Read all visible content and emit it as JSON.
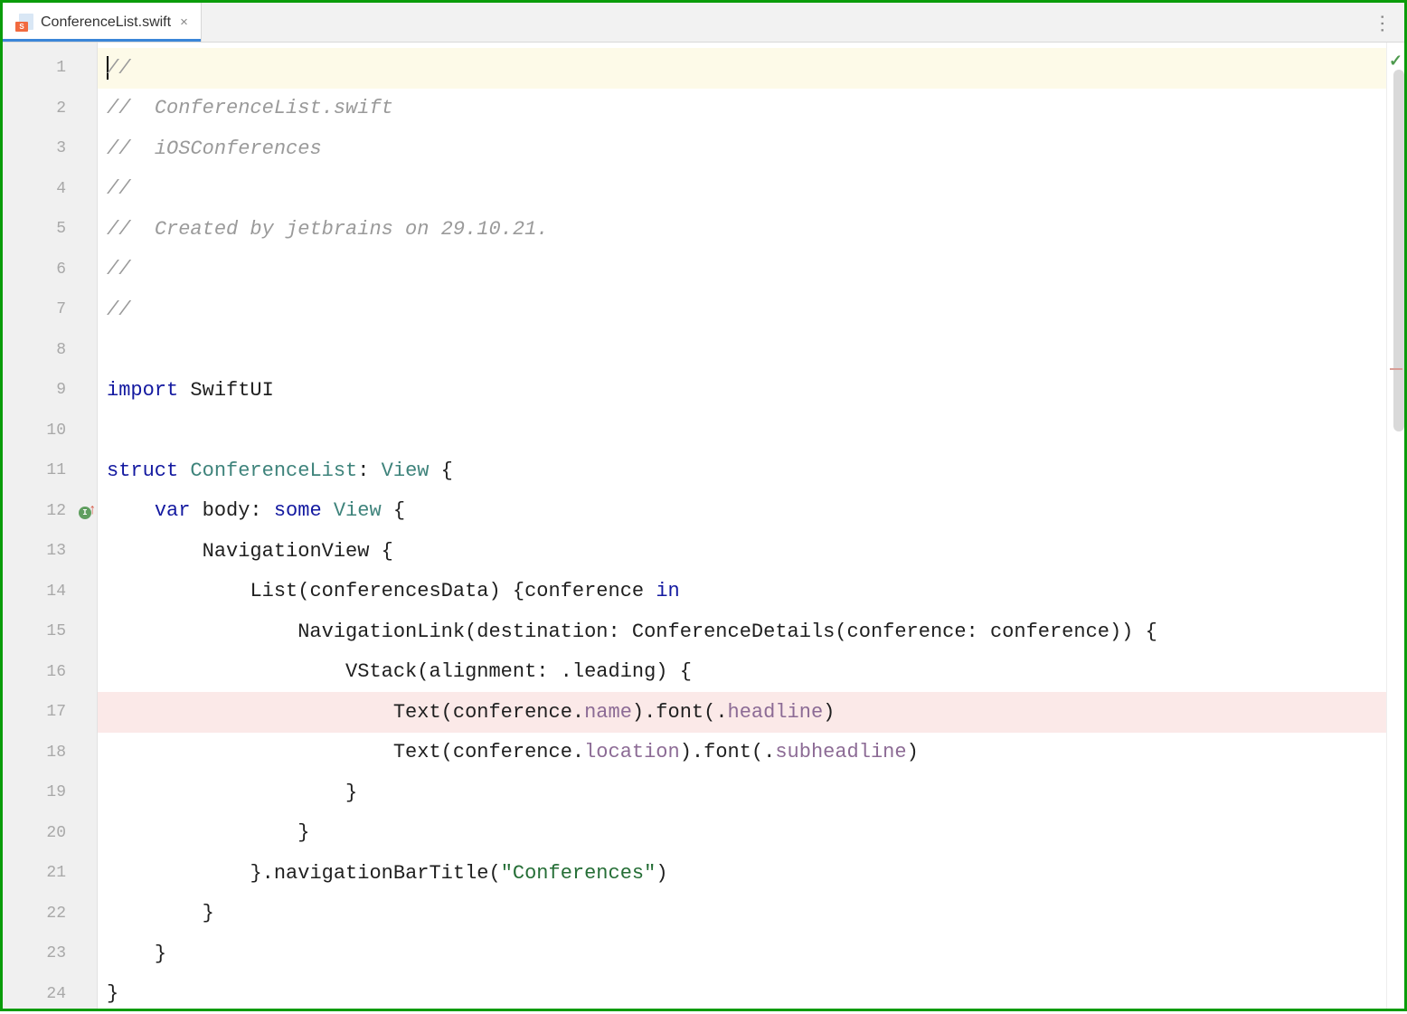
{
  "tab": {
    "filename": "ConferenceList.swift",
    "icon": "swift-file-icon"
  },
  "lineNumbers": [
    "1",
    "2",
    "3",
    "4",
    "5",
    "6",
    "7",
    "8",
    "9",
    "10",
    "11",
    "12",
    "13",
    "14",
    "15",
    "16",
    "17",
    "18",
    "19",
    "20",
    "21",
    "22",
    "23",
    "24"
  ],
  "gutterMarkers": {
    "12": "inspection-up",
    "17": "breakpoint"
  },
  "code": {
    "l1": "//",
    "l2_pre": "//  ",
    "l2_text": "ConferenceList.swift",
    "l3_pre": "//  ",
    "l3_text": "iOSConferences",
    "l4": "//",
    "l5_pre": "//  ",
    "l5_text": "Created by jetbrains on 29.10.21.",
    "l6": "//",
    "l7": "//",
    "l9_kw": "import",
    "l9_mod": " SwiftUI",
    "l11_kw": "struct",
    "l11_name": " ConferenceList",
    "l11_colon": ": ",
    "l11_proto": "View",
    "l11_brace": " {",
    "l12_indent": "    ",
    "l12_kw": "var",
    "l12_name": " body: ",
    "l12_some": "some",
    "l12_sp": " ",
    "l12_view": "View",
    "l12_brace": " {",
    "l13_indent": "        ",
    "l13_text": "NavigationView {",
    "l14_indent": "            ",
    "l14_text": "List(conferencesData) {conference ",
    "l14_in": "in",
    "l15_indent": "                ",
    "l15_text": "NavigationLink(destination: ConferenceDetails(conference: conference)) {",
    "l16_indent": "                    ",
    "l16_text": "VStack(alignment: .leading) {",
    "l17_indent": "                        ",
    "l17_a": "Text(conference.",
    "l17_name": "name",
    "l17_b": ").font(.",
    "l17_headline": "headline",
    "l17_c": ")",
    "l18_indent": "                        ",
    "l18_a": "Text(conference.",
    "l18_loc": "location",
    "l18_b": ").font(.",
    "l18_sub": "subheadline",
    "l18_c": ")",
    "l19_indent": "                    ",
    "l19_text": "}",
    "l20_indent": "                ",
    "l20_text": "}",
    "l21_indent": "            ",
    "l21_a": "}.navigationBarTitle(",
    "l21_str": "\"Conferences\"",
    "l21_b": ")",
    "l22_indent": "        ",
    "l22_text": "}",
    "l23_indent": "    ",
    "l23_text": "}",
    "l24_text": "}"
  },
  "analysis": {
    "status": "ok"
  }
}
